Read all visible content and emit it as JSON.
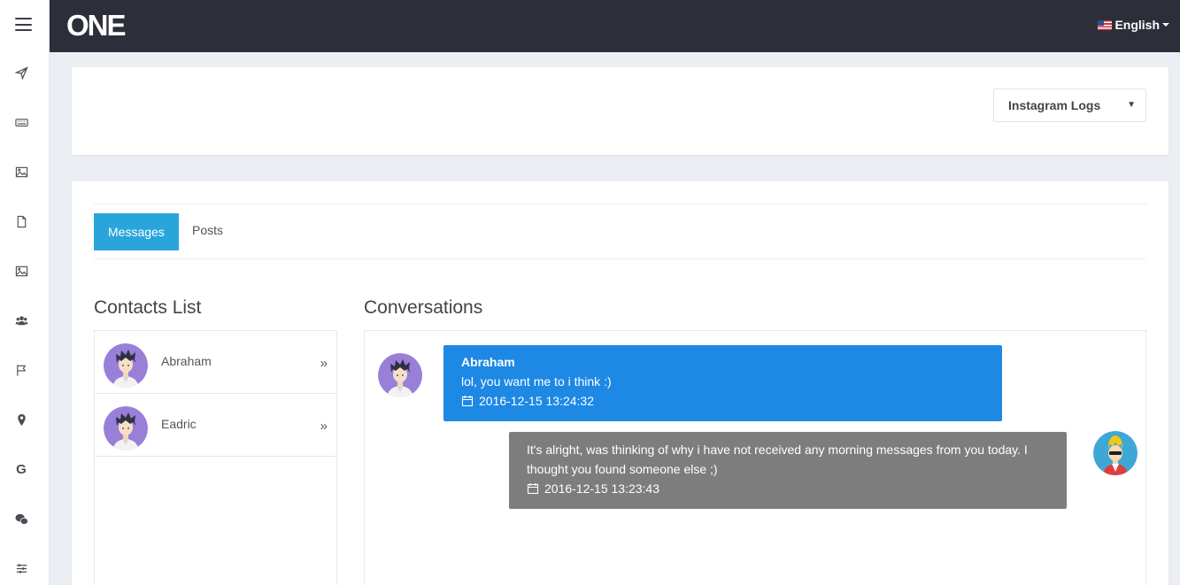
{
  "brand": {
    "logo": "ONE"
  },
  "header": {
    "language": "English"
  },
  "sidebar": {
    "icons": [
      "paper-plane-icon",
      "keyboard-icon",
      "image-icon",
      "file-icon",
      "image-icon",
      "users-icon",
      "flag-icon",
      "map-marker-icon",
      "google-icon",
      "wechat-icon",
      "sliders-icon"
    ]
  },
  "log_select": {
    "value": "Instagram Logs"
  },
  "tabs": [
    {
      "label": "Messages",
      "active": true
    },
    {
      "label": "Posts",
      "active": false
    }
  ],
  "contacts": {
    "title": "Contacts List",
    "items": [
      {
        "name": "Abraham"
      },
      {
        "name": "Eadric"
      }
    ]
  },
  "conversations": {
    "title": "Conversations",
    "messages": [
      {
        "sender": "Abraham",
        "text": "lol, you want me to i think :)",
        "timestamp": "2016-12-15 13:24:32",
        "direction": "incoming",
        "color": "#1e88e5"
      },
      {
        "sender": "",
        "text": "It's alright, was thinking of why i have not received any morning messages from you today. I thought you found someone else ;)",
        "timestamp": "2016-12-15 13:23:43",
        "direction": "outgoing",
        "color": "#7d7d7d"
      }
    ]
  },
  "colors": {
    "topbar": "#2c2f3a",
    "accent": "#2aa5dc",
    "incoming": "#1e88e5",
    "outgoing": "#7d7d7d"
  }
}
